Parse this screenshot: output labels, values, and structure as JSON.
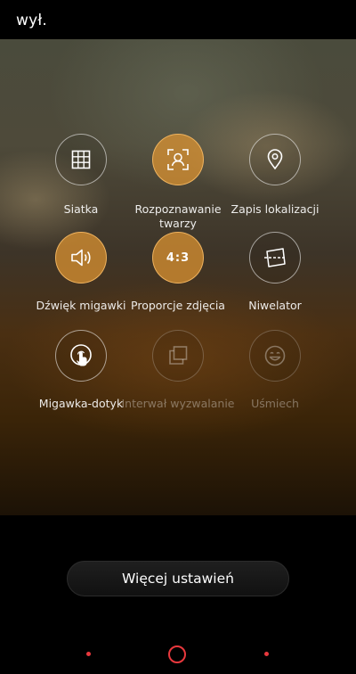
{
  "status": {
    "top_label": "wył."
  },
  "options": [
    {
      "label": "Siatka",
      "icon": "grid-icon",
      "state": "normal"
    },
    {
      "label": "Rozpoznawanie twarzy",
      "icon": "face-detect-icon",
      "state": "active"
    },
    {
      "label": "Zapis lokalizacji",
      "icon": "location-pin-icon",
      "state": "normal"
    },
    {
      "label": "Dźwięk migawki",
      "icon": "speaker-icon",
      "state": "active"
    },
    {
      "label": "Proporcje zdjęcia",
      "icon": "aspect-ratio-icon",
      "icon_text": "4:3",
      "state": "active"
    },
    {
      "label": "Niwelator",
      "icon": "level-icon",
      "state": "normal"
    },
    {
      "label": "Migawka-dotyk",
      "icon": "touch-shutter-icon",
      "state": "normal"
    },
    {
      "label": "Interwał wyzwalanie",
      "icon": "interval-icon",
      "state": "disabled"
    },
    {
      "label": "Uśmiech",
      "icon": "smile-icon",
      "state": "disabled"
    }
  ],
  "more_settings_label": "Więcej ustawień",
  "colors": {
    "accent": "#e1963a",
    "nav_red": "#e8383d"
  }
}
